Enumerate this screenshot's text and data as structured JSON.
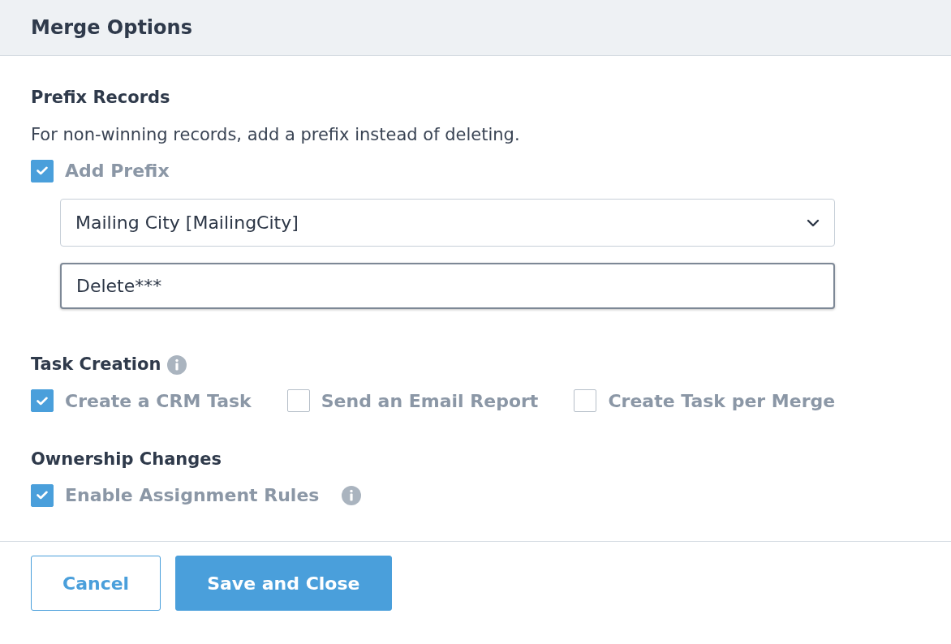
{
  "dialog": {
    "title": "Merge Options"
  },
  "sections": [
    {
      "heading": "Prefix Records",
      "heading_info": false,
      "description": "For non-winning records, add a prefix instead of deleting.",
      "options": [
        {
          "label": "Add Prefix",
          "checked": true,
          "info": false
        }
      ],
      "fields": [
        {
          "kind": "select",
          "value": "Mailing City [MailingCity]",
          "focused": false
        },
        {
          "kind": "text",
          "value": "Delete***",
          "focused": true
        }
      ]
    },
    {
      "heading": "Task Creation",
      "heading_info": true,
      "options": [
        {
          "label": "Create a CRM Task",
          "checked": true,
          "info": false
        },
        {
          "label": "Send an Email Report",
          "checked": false,
          "info": false
        },
        {
          "label": "Create Task per Merge",
          "checked": false,
          "info": false
        }
      ]
    },
    {
      "heading": "Ownership Changes",
      "heading_info": false,
      "options": [
        {
          "label": "Enable Assignment Rules",
          "checked": true,
          "info": true
        }
      ]
    }
  ],
  "buttons": [
    {
      "label": "Cancel",
      "kind": "outline"
    },
    {
      "label": "Save and Close",
      "kind": "primary"
    }
  ]
}
